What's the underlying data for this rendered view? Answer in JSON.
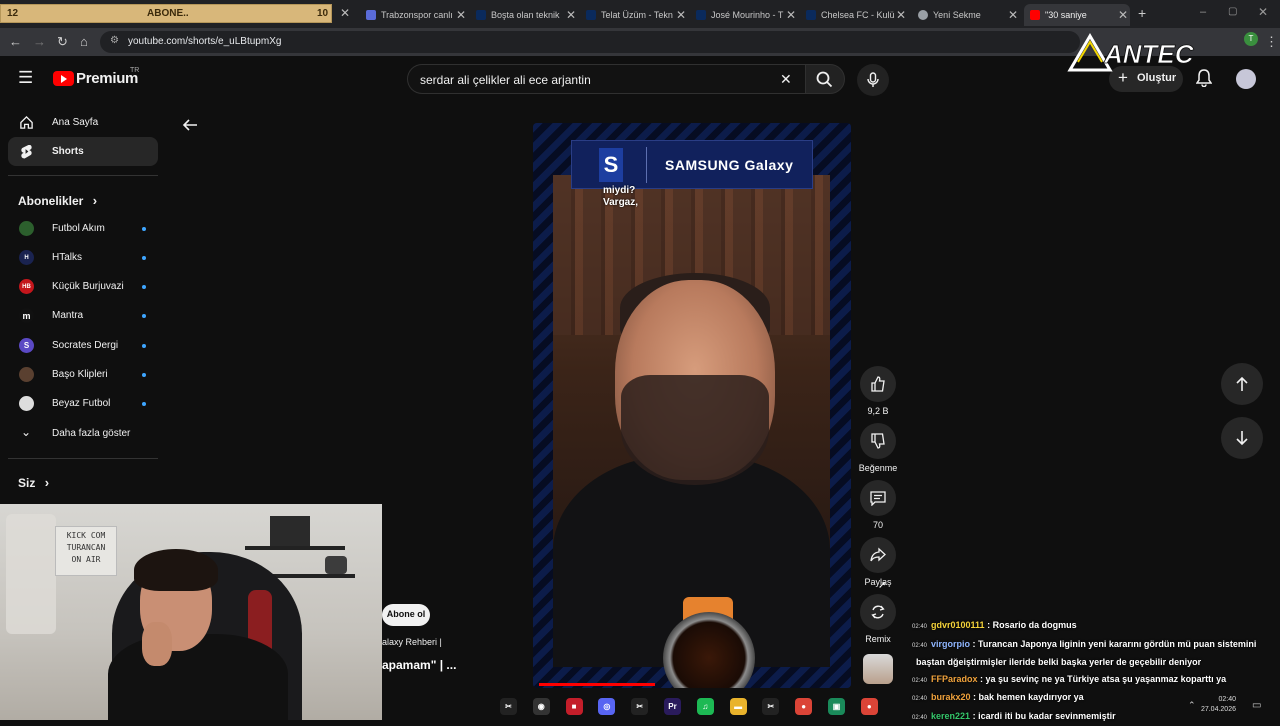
{
  "browser": {
    "subbar": {
      "left": "12",
      "center": "ABONE..",
      "right": "10"
    },
    "tabs": [
      {
        "title": "Trabzonspor canlı",
        "color": "#5a6bd8"
      },
      {
        "title": "Boşta olan teknik",
        "color": "#0a2a5c"
      },
      {
        "title": "Telat Üzüm - Tekn",
        "color": "#0a2a5c"
      },
      {
        "title": "José Mourinho - T",
        "color": "#0a2a5c"
      },
      {
        "title": "Chelsea FC - Kulü",
        "color": "#0a2a5c"
      },
      {
        "title": "Yeni Sekme",
        "color": "#9aa0a6"
      },
      {
        "title": "\"30 saniye",
        "color": "#ff0000"
      }
    ],
    "url": "youtube.com/shorts/e_uLBtupmXg"
  },
  "yt": {
    "logo": "Premium",
    "logo_region": "TR",
    "search_value": "serdar ali çelikler ali ece arjantin",
    "create_label": "Oluştur",
    "overlay_brand": "ANTEC"
  },
  "sidebar": {
    "items": [
      {
        "label": "Ana Sayfa"
      },
      {
        "label": "Shorts"
      }
    ],
    "subs_heading": "Abonelikler",
    "subs": [
      {
        "label": "Futbol Akım",
        "badge": "",
        "color": "#2c5f2d"
      },
      {
        "label": "HTalks",
        "badge": "H",
        "color": "#1a2350"
      },
      {
        "label": "Küçük Burjuvazi",
        "badge": "HB",
        "color": "#c4161c"
      },
      {
        "label": "Mantra",
        "badge": "m",
        "color": "#111111"
      },
      {
        "label": "Socrates Dergi",
        "badge": "S",
        "color": "#5b49c4"
      },
      {
        "label": "Başo Klipleri",
        "badge": "",
        "color": "#5a4030"
      },
      {
        "label": "Beyaz Futbol",
        "badge": "",
        "color": "#dddddd"
      }
    ],
    "more": "Daha fazla göster",
    "you_heading": "Siz"
  },
  "video": {
    "samsung_s": "S",
    "samsung_text": "SAMSUNG Galaxy",
    "caption_line1": "miydi?",
    "caption_line2": "Vargaz,",
    "progress_fraction": 0.38
  },
  "actions": {
    "like_count": "9,2 B",
    "dislike_label": "Beğenme",
    "comment_count": "70",
    "share_label": "Paylaş",
    "remix_label": "Remix"
  },
  "channel": {
    "subscribe_label": "Abone ol",
    "meta1": "alaxy Rehberi |",
    "meta2": "apamam\" | ..."
  },
  "cam": {
    "sign": [
      "KICK COM",
      "TURANCAN",
      "ON AIR"
    ]
  },
  "chat": [
    {
      "time": "02:40",
      "user": "gdvr0100111",
      "color": "#f5d33a",
      "msg": "Rosario da dogmus"
    },
    {
      "time": "02:40",
      "user": "virgorpio",
      "color": "#8fb6ff",
      "msg": "Turancan Japonya liginin yeni kararını gördün mü puan sistemini"
    },
    {
      "time": "",
      "user": "",
      "color": "#ffffff",
      "msg": "baştan dğeiştirmişler ileride belki başka yerler de geçebilir deniyor"
    },
    {
      "time": "02:40",
      "user": "FFParadox",
      "color": "#f0a23c",
      "msg": "ya şu sevinç ne ya Türkiye atsa şu yaşanmaz koparttı ya"
    },
    {
      "time": "02:40",
      "user": "burakx20",
      "color": "#f0a23c",
      "msg": "bak hemen kaydırıyor ya"
    },
    {
      "time": "02:40",
      "user": "keren221",
      "color": "#35c76b",
      "msg": "icardi iti bu kadar sevinmemiştir"
    }
  ],
  "taskbar": {
    "icons": [
      {
        "name": "capcut-icon",
        "label": "✂",
        "color": "#222"
      },
      {
        "name": "obs-icon",
        "label": "◉",
        "color": "#333"
      },
      {
        "name": "app-red-icon",
        "label": "■",
        "color": "#c41e2a"
      },
      {
        "name": "discord-icon",
        "label": "◎",
        "color": "#5865f2"
      },
      {
        "name": "capcut2-icon",
        "label": "✂",
        "color": "#222"
      },
      {
        "name": "premiere-icon",
        "label": "Pr",
        "color": "#2a1b5c"
      },
      {
        "name": "spotify-icon",
        "label": "♫",
        "color": "#1db954"
      },
      {
        "name": "folder-icon",
        "label": "▬",
        "color": "#e9b32c"
      },
      {
        "name": "capcut3-icon",
        "label": "✂",
        "color": "#222"
      },
      {
        "name": "chrome-icon",
        "label": "●",
        "color": "#db4437"
      },
      {
        "name": "app-green-icon",
        "label": "▣",
        "color": "#1a8a5a"
      },
      {
        "name": "chrome2-icon",
        "label": "●",
        "color": "#db4437"
      }
    ],
    "time": "02:40",
    "date": "27.04.2026"
  }
}
